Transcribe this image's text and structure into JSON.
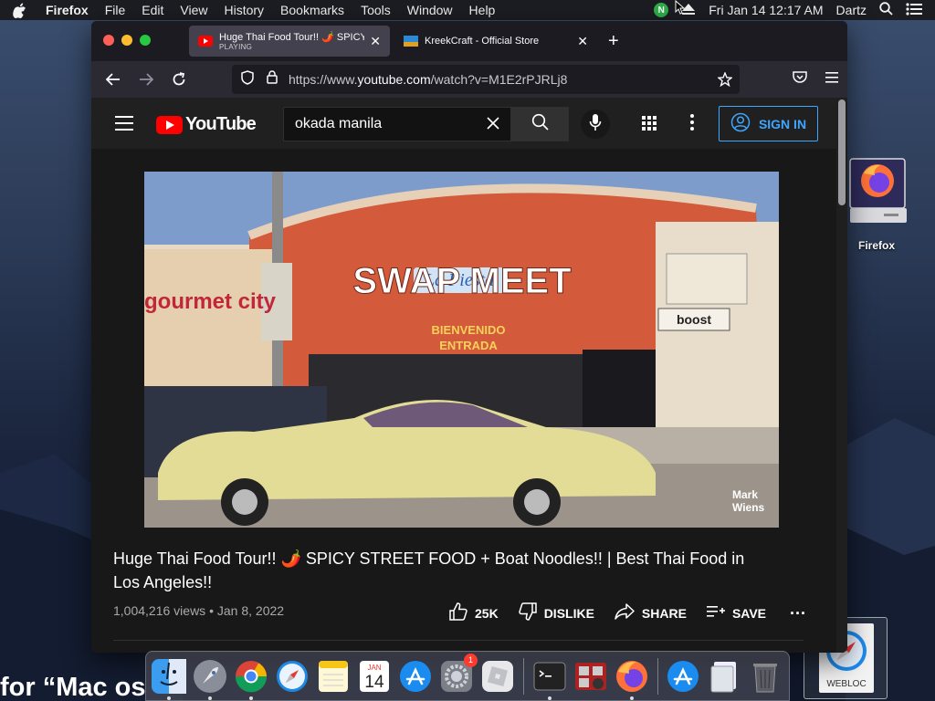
{
  "menubar": {
    "app_name": "Firefox",
    "menus": [
      "File",
      "Edit",
      "View",
      "History",
      "Bookmarks",
      "Tools",
      "Window",
      "Help"
    ],
    "status_badge": "N",
    "datetime": "Fri Jan 14  12:17 AM",
    "user": "Dartz"
  },
  "desktop": {
    "firefox_label": "Firefox",
    "webloc_label": "WEBLOC",
    "partial_text": "for “Mac os"
  },
  "browser": {
    "tabs": [
      {
        "title": "Huge Thai Food Tour!! 🌶️ SPICY",
        "status": "PLAYING",
        "active": true
      },
      {
        "title": "KreekCraft - Official Store",
        "active": false
      }
    ],
    "url_prefix": "https://www.",
    "url_domain": "youtube.com",
    "url_path": "/watch?v=M1E2rPJRLj8"
  },
  "youtube": {
    "logo_text": "YouTube",
    "search_query": "okada manila",
    "sign_in_label": "SIGN IN",
    "video": {
      "title": "Huge Thai Food Tour!! 🌶️ SPICY STREET FOOD + Boat Noodles!! | Best Thai Food in Los Angeles!!",
      "views": "1,004,216 views",
      "date": "Jan 8, 2022",
      "likes": "25K",
      "dislike_label": "DISLIKE",
      "share_label": "SHARE",
      "save_label": "SAVE",
      "more_label": "...",
      "scene_text": {
        "sign_main": "SWAP MEET",
        "sign_script": "La Fiesta",
        "bienvenido": "BIENVENIDO",
        "entrada": "ENTRADA",
        "gourmet": "gourmet city",
        "boost": "boost",
        "watermark_1": "Mark",
        "watermark_2": "Wiens"
      }
    }
  },
  "dock": {
    "calendar_month": "JAN",
    "calendar_day": "14",
    "settings_badge": "1"
  },
  "colors": {
    "youtube_red": "#ff0000",
    "signin_blue": "#3ea6ff",
    "firefox_orange": "#ff7139"
  }
}
